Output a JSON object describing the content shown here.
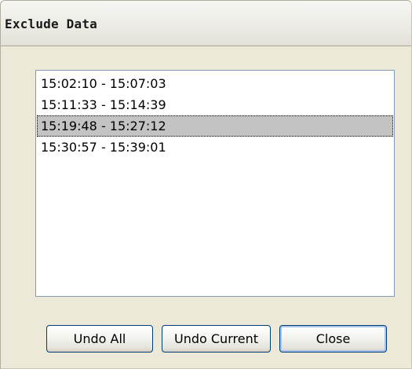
{
  "window": {
    "title": "Exclude Data"
  },
  "list": {
    "items": [
      "15:02:10 - 15:07:03",
      "15:11:33 - 15:14:39",
      "15:19:48 - 15:27:12",
      "15:30:57 - 15:39:01"
    ],
    "selected_index": 2
  },
  "buttons": {
    "undo_all": "Undo All",
    "undo_current": "Undo Current",
    "close": "Close"
  },
  "colors": {
    "dialog_bg": "#ece9d8",
    "selection_bg": "#c3c3c3",
    "list_border": "#7f9db9",
    "button_border": "#003c74"
  }
}
